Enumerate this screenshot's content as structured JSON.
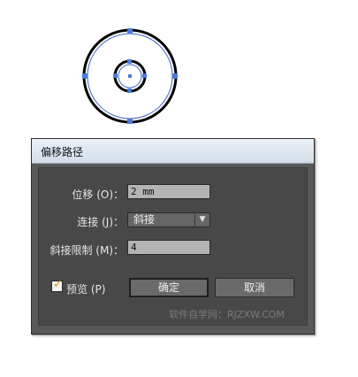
{
  "dialog": {
    "title": "偏移路径",
    "offset": {
      "label": "位移 (O)：",
      "value": "2 mm"
    },
    "joins": {
      "label": "连接 (J)：",
      "value": "斜接"
    },
    "miter_limit": {
      "label": "斜接限制 (M)：",
      "value": "4"
    },
    "preview": {
      "label": "预览 (P)",
      "checked": true
    },
    "ok_label": "确定",
    "cancel_label": "取消"
  },
  "watermark": "软件自学网：RJZXW.COM",
  "colors": {
    "selection_handle": "#4a7bd8",
    "stroke": "#000000",
    "check_mark": "#e08a10"
  }
}
